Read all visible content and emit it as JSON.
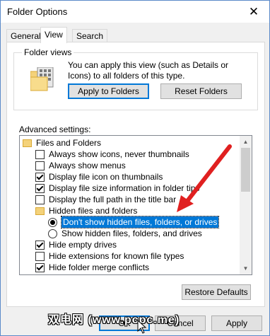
{
  "window": {
    "title": "Folder Options",
    "close_glyph": "✕"
  },
  "tabs": [
    {
      "label": "General"
    },
    {
      "label": "View"
    },
    {
      "label": "Search"
    }
  ],
  "folder_views": {
    "label": "Folder views",
    "description": "You can apply this view (such as Details or Icons) to all folders of this type.",
    "apply_button": "Apply to Folders",
    "reset_button": "Reset Folders"
  },
  "advanced": {
    "label": "Advanced settings:",
    "items": [
      {
        "type": "folder",
        "label": "Files and Folders"
      },
      {
        "type": "checkbox",
        "checked": false,
        "label": "Always show icons, never thumbnails"
      },
      {
        "type": "checkbox",
        "checked": false,
        "label": "Always show menus"
      },
      {
        "type": "checkbox",
        "checked": true,
        "label": "Display file icon on thumbnails"
      },
      {
        "type": "checkbox",
        "checked": true,
        "label": "Display file size information in folder tips"
      },
      {
        "type": "checkbox",
        "checked": false,
        "label": "Display the full path in the title bar"
      },
      {
        "type": "folder",
        "label": "Hidden files and folders"
      },
      {
        "type": "radio",
        "checked": true,
        "selected": true,
        "label": "Don't show hidden files, folders, or drives"
      },
      {
        "type": "radio",
        "checked": false,
        "label": "Show hidden files, folders, and drives"
      },
      {
        "type": "checkbox",
        "checked": true,
        "label": "Hide empty drives"
      },
      {
        "type": "checkbox",
        "checked": false,
        "label": "Hide extensions for known file types"
      },
      {
        "type": "checkbox",
        "checked": true,
        "label": "Hide folder merge conflicts"
      }
    ]
  },
  "restore_defaults_button": "Restore Defaults",
  "footer": {
    "ok_button": "OK",
    "cancel_button": "Cancel",
    "apply_button": "Apply"
  },
  "watermark": "双电网 (www.pcpc.me)",
  "colors": {
    "selection": "#0078d7",
    "annotation_arrow": "#e02020"
  }
}
